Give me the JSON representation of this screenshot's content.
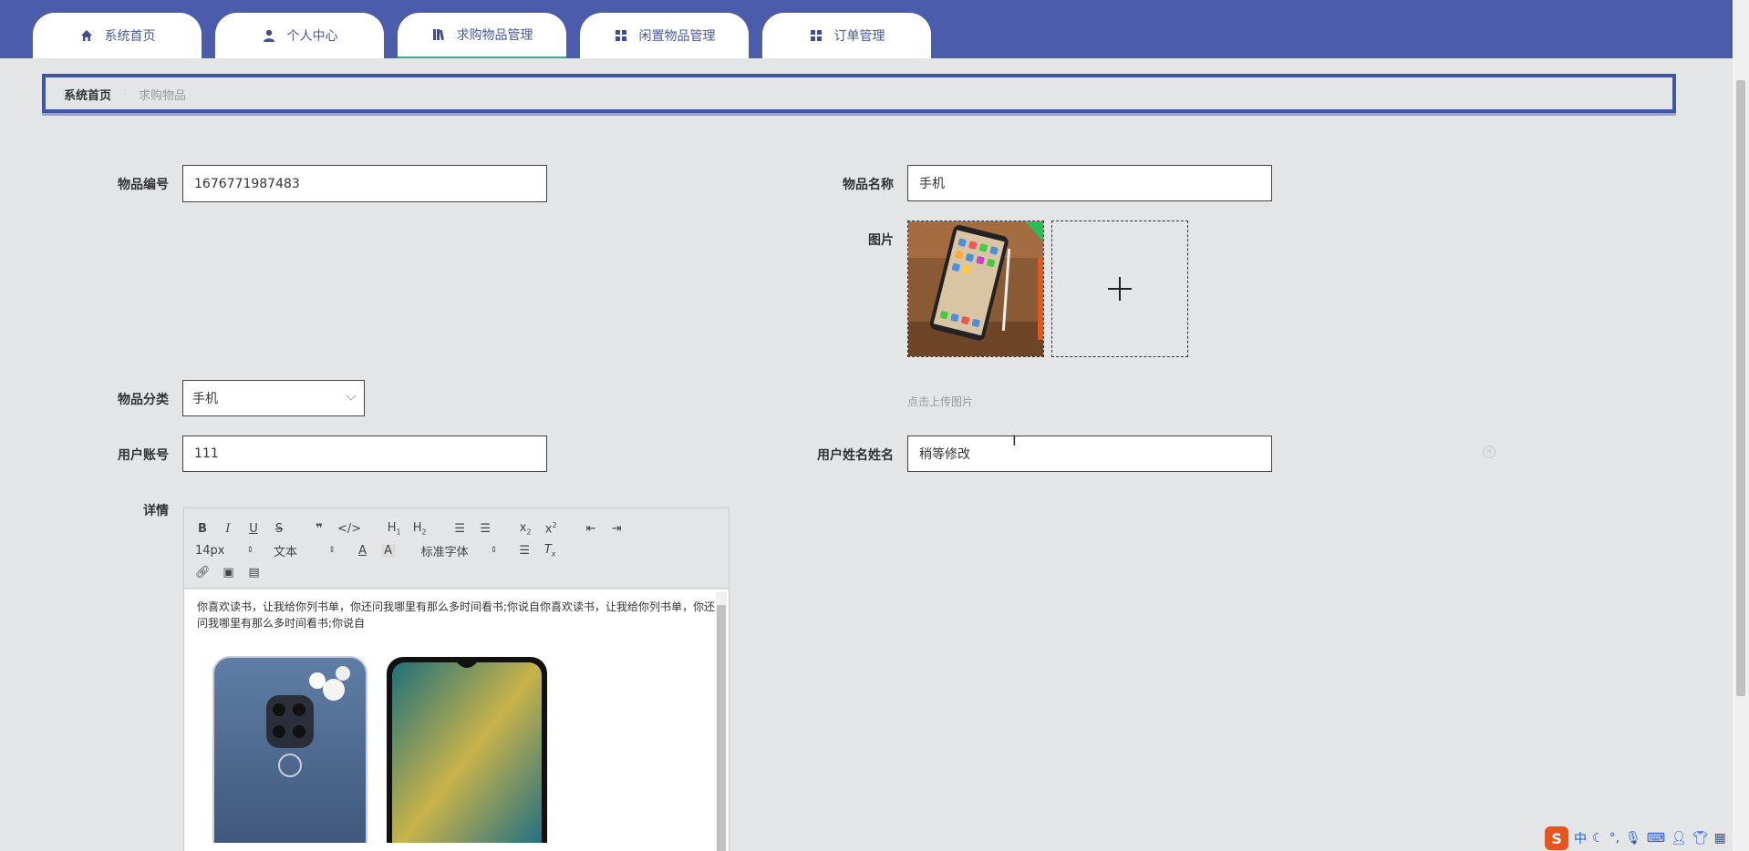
{
  "nav": {
    "tabs": [
      {
        "label": "系统首页",
        "icon": "home-icon"
      },
      {
        "label": "个人中心",
        "icon": "user-icon"
      },
      {
        "label": "求购物品管理",
        "icon": "book-icon"
      },
      {
        "label": "闲置物品管理",
        "icon": "grid-icon"
      },
      {
        "label": "订单管理",
        "icon": "grid-icon"
      }
    ],
    "active_index": 2,
    "bar_color": "#4a5cab"
  },
  "breadcrumb": {
    "home": "系统首页",
    "current": "求购物品"
  },
  "form": {
    "item_no": {
      "label": "物品编号",
      "value": "1676771987483"
    },
    "item_name": {
      "label": "物品名称",
      "value": "手机"
    },
    "picture": {
      "label": "图片",
      "hint": "点击上传图片"
    },
    "category": {
      "label": "物品分类",
      "value": "手机"
    },
    "account": {
      "label": "用户账号",
      "value": "111"
    },
    "username": {
      "label": "用户姓名姓名",
      "value": "稍等修改"
    },
    "details": {
      "label": "详情"
    }
  },
  "editor": {
    "font_size": "14px",
    "paragraph": "文本",
    "font_family": "标准字体",
    "content_text": "你喜欢读书，让我给你列书单，你还问我哪里有那么多时间看书;你说自你喜欢读书，让我给你列书单，你还问我哪里有那么多时间看书;你说自"
  },
  "ime": {
    "lang": "中"
  }
}
